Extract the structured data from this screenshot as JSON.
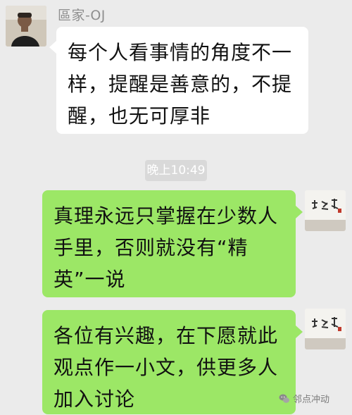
{
  "incoming": {
    "sender_name": "區家-OJ",
    "avatar_icon": "person-avatar",
    "message": "每个人看事情的角度不一样，提醒是善意的，不提醒，也无可厚非"
  },
  "timestamp": "晚上10:49",
  "outgoing": [
    {
      "message": "真理永远只掌握在少数人手里，否则就没有“精英”一说",
      "avatar_icon": "calligraphy-avatar"
    },
    {
      "message": "各位有兴趣，在下愿就此观点作一小文，供更多人加入讨论",
      "avatar_icon": "calligraphy-avatar"
    }
  ],
  "watermark": {
    "text": "邻点冲动",
    "icon": "wechat-icon"
  },
  "colors": {
    "background": "#ebebeb",
    "incoming_bubble": "#ffffff",
    "outgoing_bubble": "#9ce766",
    "timestamp_bg": "#d9d9d9"
  }
}
